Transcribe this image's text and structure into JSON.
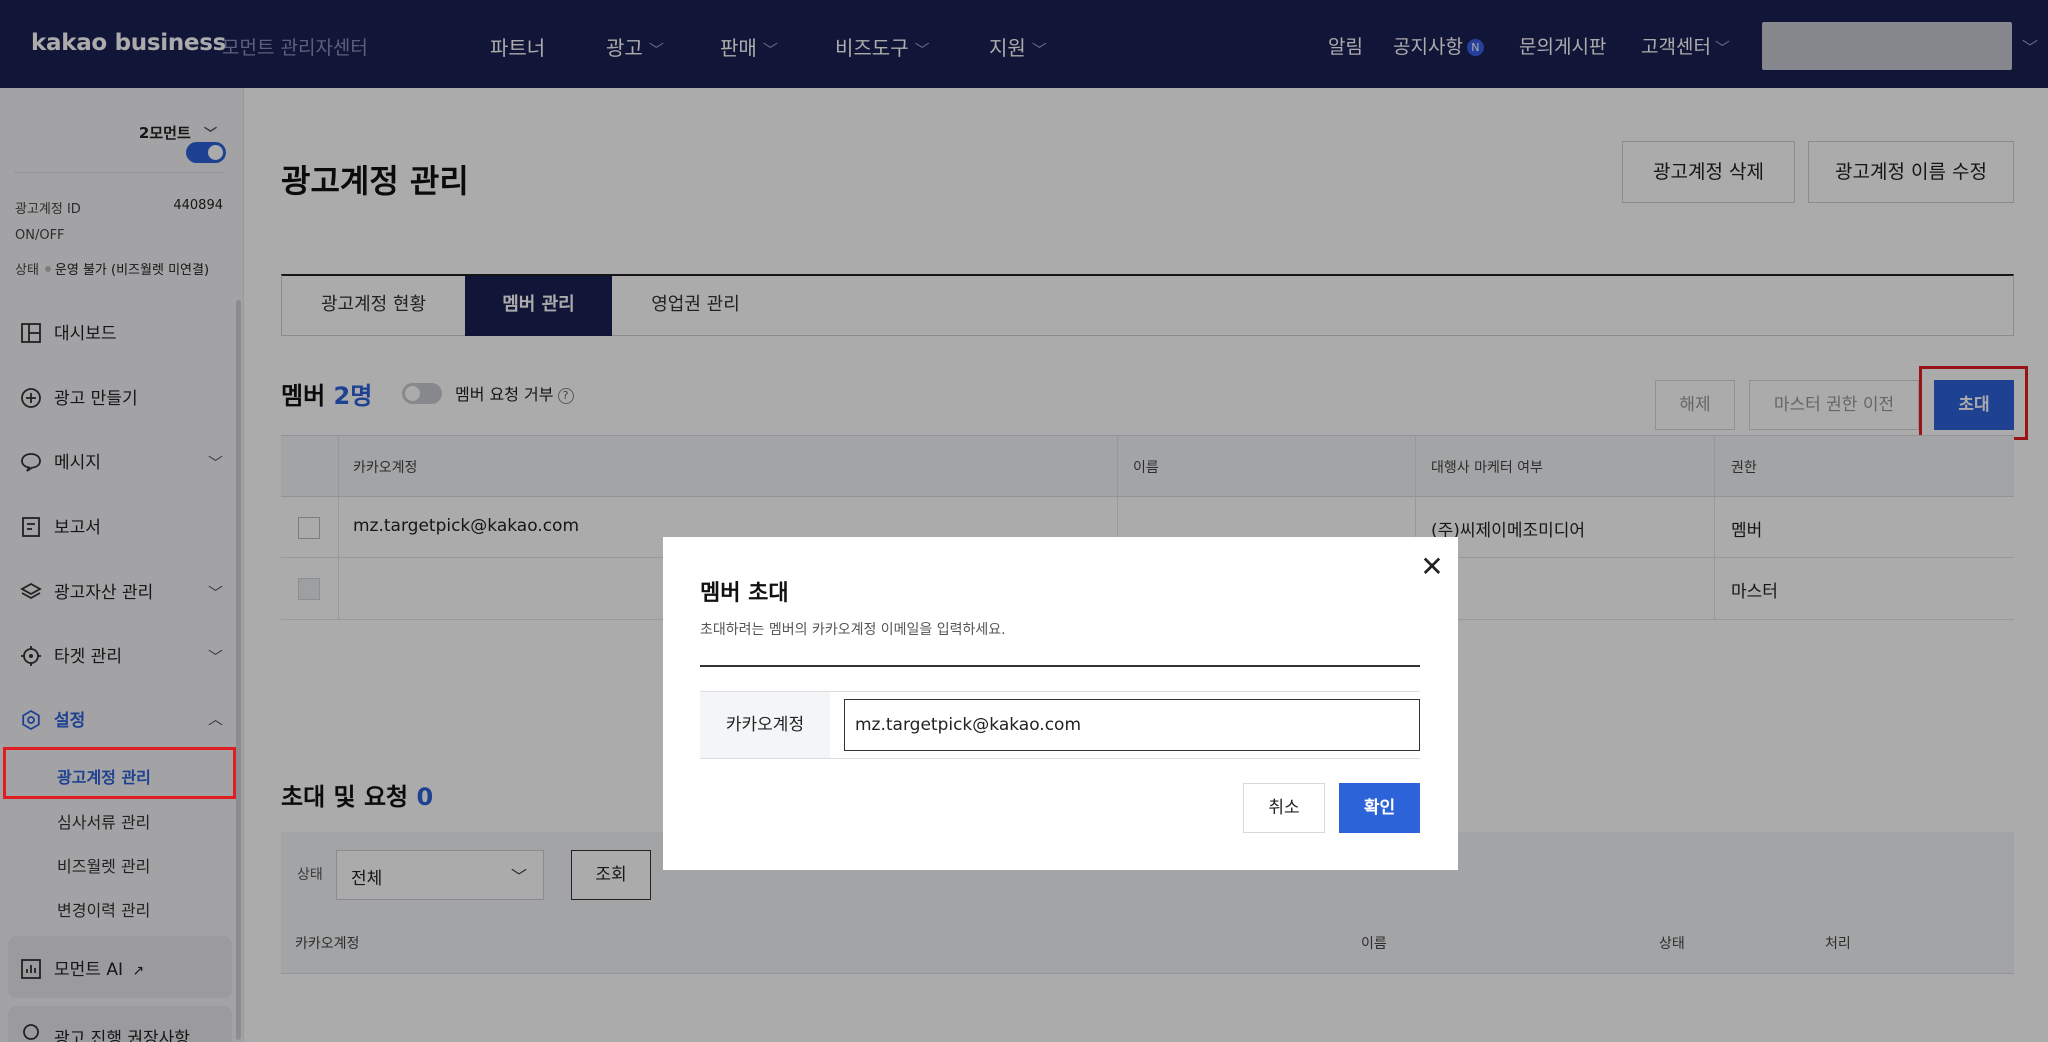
{
  "topnav": {
    "logo": "kakao business",
    "logo_sub": "모먼트 관리자센터",
    "menu": [
      {
        "label": "파트너"
      },
      {
        "label": "광고"
      },
      {
        "label": "판매"
      },
      {
        "label": "비즈도구"
      },
      {
        "label": "지원"
      }
    ],
    "right": {
      "alert": "알림",
      "notice": "공지사항",
      "notice_badge": "N",
      "board": "문의게시판",
      "support": "고객센터"
    }
  },
  "sidebar": {
    "account_name": "2모먼트",
    "account_id_label": "광고계정 ID",
    "account_id_value": "440894",
    "onoff_label": "ON/OFF",
    "onoff_state": true,
    "status_label": "상태",
    "status_value": "운영 불가 (비즈월렛 미연결)",
    "menu": [
      {
        "label": "대시보드",
        "icon": "dashboard-icon"
      },
      {
        "label": "광고 만들기",
        "icon": "plus-circle-icon"
      },
      {
        "label": "메시지",
        "icon": "chat-bubble-icon"
      },
      {
        "label": "보고서",
        "icon": "report-icon"
      },
      {
        "label": "광고자산 관리",
        "icon": "layers-icon"
      },
      {
        "label": "타겟 관리",
        "icon": "target-icon"
      },
      {
        "label": "설정",
        "icon": "settings-icon"
      }
    ],
    "submenu": [
      {
        "label": "광고계정 관리"
      },
      {
        "label": "심사서류 관리"
      },
      {
        "label": "비즈월렛 관리"
      },
      {
        "label": "변경이력 관리"
      }
    ],
    "ai_label": "모먼트 AI",
    "bottom_label": "광고 진행 권장사항"
  },
  "main": {
    "title": "광고계정 관리",
    "delete_button": "광고계정 삭제",
    "rename_button": "광고계정 이름 수정",
    "tabs": [
      {
        "label": "광고계정 현황"
      },
      {
        "label": "멤버 관리"
      },
      {
        "label": "영업권 관리"
      }
    ],
    "members": {
      "title": "멤버",
      "count": "2명",
      "reject_label": "멤버 요청 거부",
      "help": "?",
      "release_button": "해제",
      "transfer_button": "마스터 권한 이전",
      "invite_button": "초대",
      "columns": [
        "카카오계정",
        "이름",
        "대행사 마케터 여부",
        "권한"
      ],
      "rows": [
        {
          "account": "mz.targetpick@kakao.com",
          "name": "",
          "agency": "(주)씨제이메조미디어",
          "role": "멤버"
        },
        {
          "account": "",
          "name": "",
          "agency": "",
          "role": "마스터"
        }
      ]
    },
    "invites": {
      "title": "초대 및 요청",
      "count": "0",
      "filter_label": "상태",
      "filter_value": "전체",
      "search_button": "조회",
      "columns": [
        "카카오계정",
        "이름",
        "상태",
        "처리"
      ]
    }
  },
  "modal": {
    "title": "멤버 초대",
    "close": "✕",
    "description": "초대하려는 멤버의 카카오계정 이메일을 입력하세요.",
    "field_label": "카카오계정",
    "field_value": "mz.targetpick@kakao.com",
    "cancel": "취소",
    "confirm": "확인"
  },
  "colors": {
    "nav_bg": "#1a2154",
    "accent": "#2d63d8",
    "highlight": "#e21d22"
  }
}
